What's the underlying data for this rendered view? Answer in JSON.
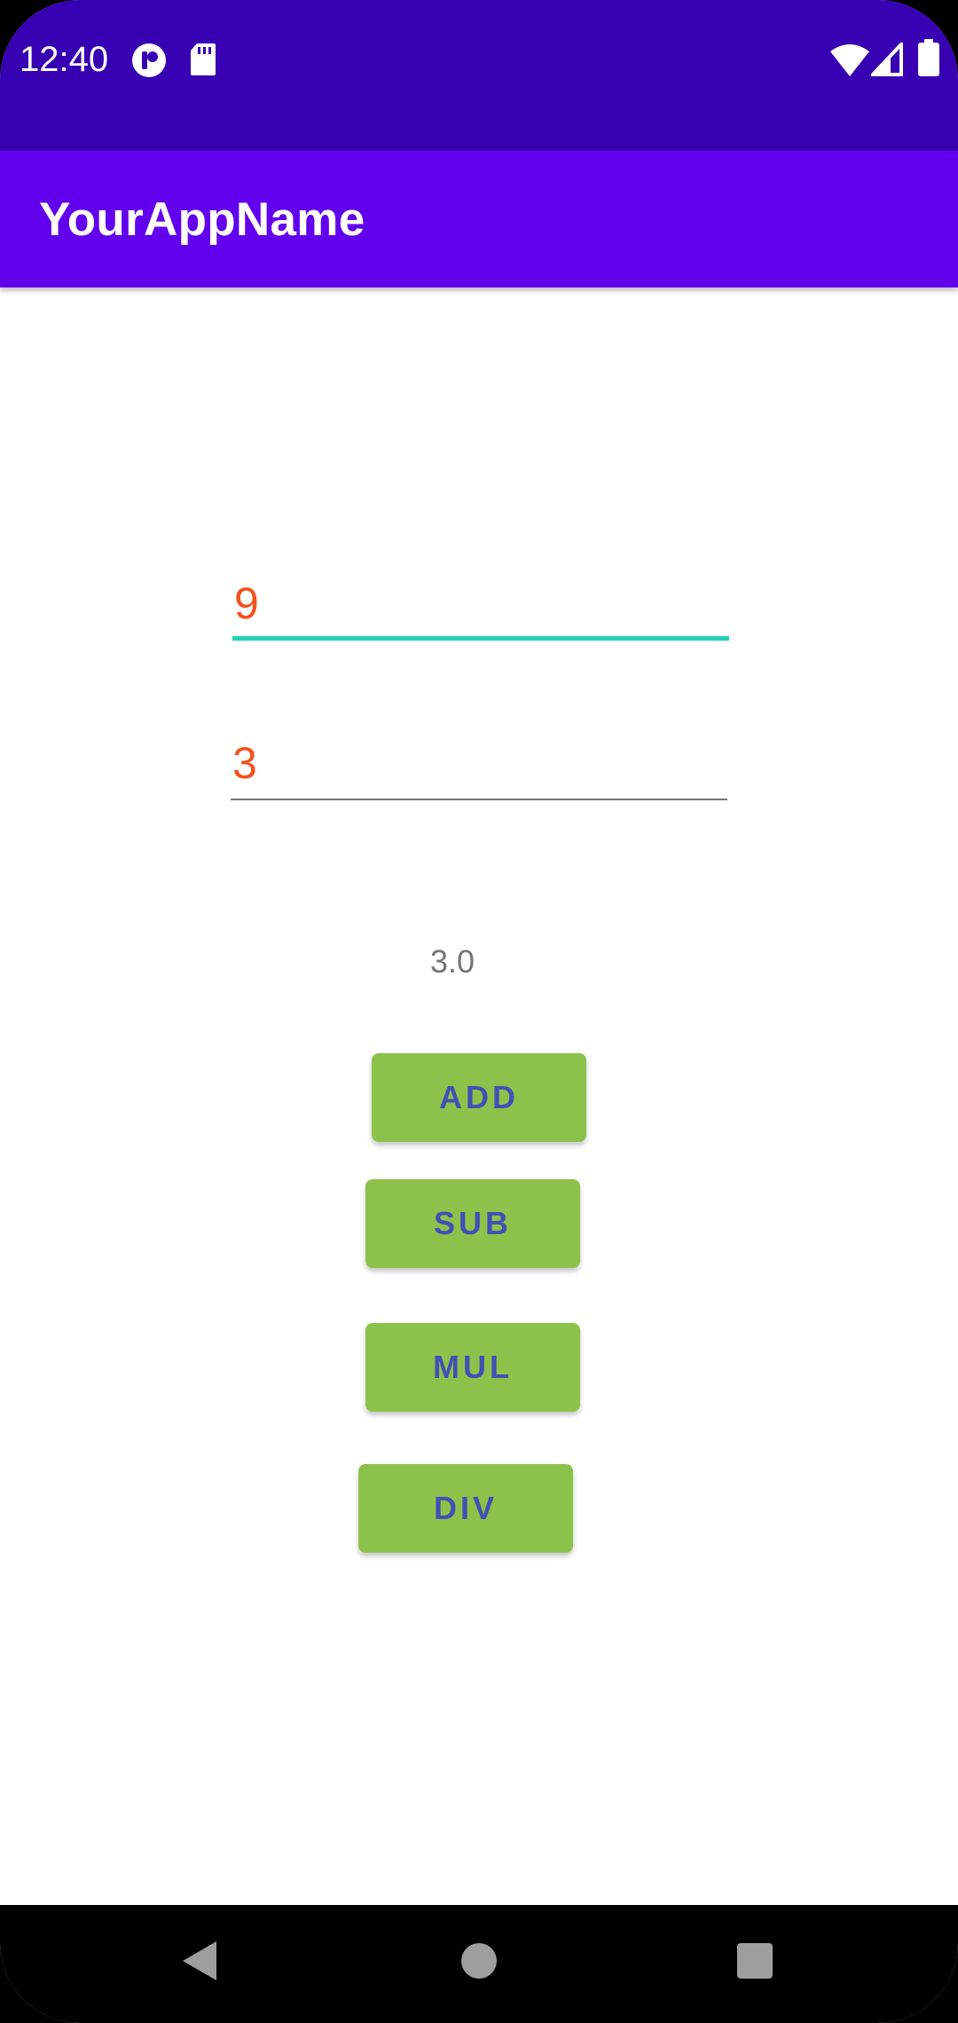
{
  "status_bar": {
    "time": "12:40",
    "icons": [
      "notification-app-icon",
      "sd-card-icon",
      "wifi-icon",
      "cellular-signal-icon",
      "battery-icon"
    ],
    "background": "#3700b3"
  },
  "app_bar": {
    "title": "YourAppName",
    "background": "#6200ee"
  },
  "inputs": {
    "first_number": "9",
    "second_number": "3",
    "focused_underline_color": "#1ed2b8",
    "text_color": "#f4511e"
  },
  "result": {
    "value": "3.0"
  },
  "buttons": {
    "add": "ADD",
    "sub": "SUB",
    "mul": "MUL",
    "div": "DIV",
    "background": "#8bc34a",
    "text_color": "#3f51b5"
  },
  "nav_bar": {
    "icons": [
      "back-icon",
      "home-icon",
      "recents-icon"
    ]
  }
}
